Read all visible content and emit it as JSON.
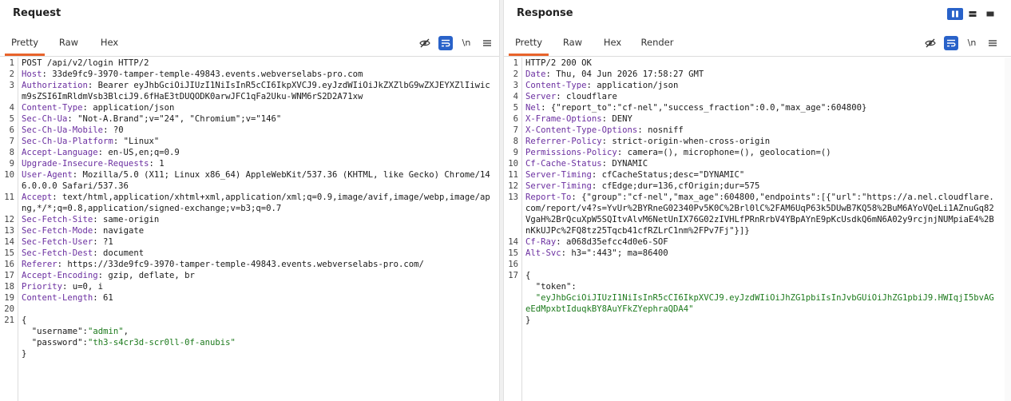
{
  "request": {
    "title": "Request",
    "tabs": [
      "Pretty",
      "Raw",
      "Hex"
    ],
    "active_tab": "Pretty",
    "newline_toggle": "\\n",
    "lines": [
      {
        "n": "1",
        "parts": [
          {
            "t": "POST /api/v2/login HTTP/2",
            "c": "hv"
          }
        ]
      },
      {
        "n": "2",
        "parts": [
          {
            "t": "Host",
            "c": "hk"
          },
          {
            "t": ": 33de9fc9-3970-tamper-temple-49843.events.webverselabs-pro.com",
            "c": "hv"
          }
        ]
      },
      {
        "n": "3",
        "parts": [
          {
            "t": "Authorization",
            "c": "hk"
          },
          {
            "t": ": Bearer eyJhbGciOiJIUzI1NiIsInR5cCI6IkpXVCJ9.eyJzdWIiOiJkZXZlbG9wZXJEYXZlIiwicm9sZSI6ImRldmVsb3BlciJ9.6fHaE3tDUQODK0arwJFC1qFa2Uku-WNM6rS2D2A71xw",
            "c": "hv"
          }
        ]
      },
      {
        "n": "4",
        "parts": [
          {
            "t": "Content-Type",
            "c": "hk"
          },
          {
            "t": ": application/json",
            "c": "hv"
          }
        ]
      },
      {
        "n": "5",
        "parts": [
          {
            "t": "Sec-Ch-Ua",
            "c": "hk"
          },
          {
            "t": ": \"Not-A.Brand\";v=\"24\", \"Chromium\";v=\"146\"",
            "c": "hv"
          }
        ]
      },
      {
        "n": "6",
        "parts": [
          {
            "t": "Sec-Ch-Ua-Mobile",
            "c": "hk"
          },
          {
            "t": ": ?0",
            "c": "hv"
          }
        ]
      },
      {
        "n": "7",
        "parts": [
          {
            "t": "Sec-Ch-Ua-Platform",
            "c": "hk"
          },
          {
            "t": ": \"Linux\"",
            "c": "hv"
          }
        ]
      },
      {
        "n": "8",
        "parts": [
          {
            "t": "Accept-Language",
            "c": "hk"
          },
          {
            "t": ": en-US,en;q=0.9",
            "c": "hv"
          }
        ]
      },
      {
        "n": "9",
        "parts": [
          {
            "t": "Upgrade-Insecure-Requests",
            "c": "hk"
          },
          {
            "t": ": 1",
            "c": "hv"
          }
        ]
      },
      {
        "n": "10",
        "parts": [
          {
            "t": "User-Agent",
            "c": "hk"
          },
          {
            "t": ": Mozilla/5.0 (X11; Linux x86_64) AppleWebKit/537.36 (KHTML, like Gecko) Chrome/146.0.0.0 Safari/537.36",
            "c": "hv"
          }
        ]
      },
      {
        "n": "11",
        "parts": [
          {
            "t": "Accept",
            "c": "hk"
          },
          {
            "t": ": text/html,application/xhtml+xml,application/xml;q=0.9,image/avif,image/webp,image/apng,*/*;q=0.8,application/signed-exchange;v=b3;q=0.7",
            "c": "hv"
          }
        ]
      },
      {
        "n": "12",
        "parts": [
          {
            "t": "Sec-Fetch-Site",
            "c": "hk"
          },
          {
            "t": ": same-origin",
            "c": "hv"
          }
        ]
      },
      {
        "n": "13",
        "parts": [
          {
            "t": "Sec-Fetch-Mode",
            "c": "hk"
          },
          {
            "t": ": navigate",
            "c": "hv"
          }
        ]
      },
      {
        "n": "14",
        "parts": [
          {
            "t": "Sec-Fetch-User",
            "c": "hk"
          },
          {
            "t": ": ?1",
            "c": "hv"
          }
        ]
      },
      {
        "n": "15",
        "parts": [
          {
            "t": "Sec-Fetch-Dest",
            "c": "hk"
          },
          {
            "t": ": document",
            "c": "hv"
          }
        ]
      },
      {
        "n": "16",
        "parts": [
          {
            "t": "Referer",
            "c": "hk"
          },
          {
            "t": ": https://33de9fc9-3970-tamper-temple-49843.events.webverselabs-pro.com/",
            "c": "hv"
          }
        ]
      },
      {
        "n": "17",
        "parts": [
          {
            "t": "Accept-Encoding",
            "c": "hk"
          },
          {
            "t": ": gzip, deflate, br",
            "c": "hv"
          }
        ]
      },
      {
        "n": "18",
        "parts": [
          {
            "t": "Priority",
            "c": "hk"
          },
          {
            "t": ": u=0, i",
            "c": "hv"
          }
        ]
      },
      {
        "n": "19",
        "parts": [
          {
            "t": "Content-Length",
            "c": "hk"
          },
          {
            "t": ": 61",
            "c": "hv"
          }
        ]
      },
      {
        "n": "20",
        "parts": [
          {
            "t": "",
            "c": "hv"
          }
        ]
      },
      {
        "n": "21",
        "parts": [
          {
            "t": "{",
            "c": "hv"
          }
        ]
      },
      {
        "n": "",
        "parts": [
          {
            "t": "  ",
            "c": "hv"
          },
          {
            "t": "\"username\"",
            "c": "jk"
          },
          {
            "t": ":",
            "c": "hv"
          },
          {
            "t": "\"admin\"",
            "c": "js"
          },
          {
            "t": ",",
            "c": "hv"
          }
        ]
      },
      {
        "n": "",
        "parts": [
          {
            "t": "  ",
            "c": "hv"
          },
          {
            "t": "\"password\"",
            "c": "jk"
          },
          {
            "t": ":",
            "c": "hv"
          },
          {
            "t": "\"th3-s4cr3d-scr0ll-0f-anubis\"",
            "c": "js"
          }
        ]
      },
      {
        "n": "",
        "parts": [
          {
            "t": "}",
            "c": "hv"
          }
        ]
      }
    ]
  },
  "response": {
    "title": "Response",
    "tabs": [
      "Pretty",
      "Raw",
      "Hex",
      "Render"
    ],
    "active_tab": "Pretty",
    "newline_toggle": "\\n",
    "lines": [
      {
        "n": "1",
        "parts": [
          {
            "t": "HTTP/2 200 OK",
            "c": "hv"
          }
        ]
      },
      {
        "n": "2",
        "parts": [
          {
            "t": "Date",
            "c": "hk"
          },
          {
            "t": ": Thu, 04 Jun 2026 17:58:27 GMT",
            "c": "hv"
          }
        ]
      },
      {
        "n": "3",
        "parts": [
          {
            "t": "Content-Type",
            "c": "hk"
          },
          {
            "t": ": application/json",
            "c": "hv"
          }
        ]
      },
      {
        "n": "4",
        "parts": [
          {
            "t": "Server",
            "c": "hk"
          },
          {
            "t": ": cloudflare",
            "c": "hv"
          }
        ]
      },
      {
        "n": "5",
        "parts": [
          {
            "t": "Nel",
            "c": "hk"
          },
          {
            "t": ": {\"report_to\":\"cf-nel\",\"success_fraction\":0.0,\"max_age\":604800}",
            "c": "hv"
          }
        ]
      },
      {
        "n": "6",
        "parts": [
          {
            "t": "X-Frame-Options",
            "c": "hk"
          },
          {
            "t": ": DENY",
            "c": "hv"
          }
        ]
      },
      {
        "n": "7",
        "parts": [
          {
            "t": "X-Content-Type-Options",
            "c": "hk"
          },
          {
            "t": ": nosniff",
            "c": "hv"
          }
        ]
      },
      {
        "n": "8",
        "parts": [
          {
            "t": "Referrer-Policy",
            "c": "hk"
          },
          {
            "t": ": strict-origin-when-cross-origin",
            "c": "hv"
          }
        ]
      },
      {
        "n": "9",
        "parts": [
          {
            "t": "Permissions-Policy",
            "c": "hk"
          },
          {
            "t": ": camera=(), microphone=(), geolocation=()",
            "c": "hv"
          }
        ]
      },
      {
        "n": "10",
        "parts": [
          {
            "t": "Cf-Cache-Status",
            "c": "hk"
          },
          {
            "t": ": DYNAMIC",
            "c": "hv"
          }
        ]
      },
      {
        "n": "11",
        "parts": [
          {
            "t": "Server-Timing",
            "c": "hk"
          },
          {
            "t": ": cfCacheStatus;desc=\"DYNAMIC\"",
            "c": "hv"
          }
        ]
      },
      {
        "n": "12",
        "parts": [
          {
            "t": "Server-Timing",
            "c": "hk"
          },
          {
            "t": ": cfEdge;dur=136,cfOrigin;dur=575",
            "c": "hv"
          }
        ]
      },
      {
        "n": "13",
        "parts": [
          {
            "t": "Report-To",
            "c": "hk"
          },
          {
            "t": ": {\"group\":\"cf-nel\",\"max_age\":604800,\"endpoints\":[{\"url\":\"https://a.nel.cloudflare.com/report/v4?s=YvUr%2BYRneG02340Pv5K0C%2Brl0lC%2FAM6UqP63k5DUwB7KQ58%2BuM6AYoVQeLi1AZnuGq82VgaH%2BrQcuXpW5SQItvAlvM6NetUnIX76G02zIVHLfPRnRrbV4YBpAYnE9pKcUsdkQ6mN6A02y9rcjnjNUMpiaE4%2BnKkUJPc%2FQ8tz25Tqcb41cfRZLrC1nm%2FPv7Fj\"}]}",
            "c": "hv"
          }
        ]
      },
      {
        "n": "14",
        "parts": [
          {
            "t": "Cf-Ray",
            "c": "hk"
          },
          {
            "t": ": a068d35efcc4d0e6-SOF",
            "c": "hv"
          }
        ]
      },
      {
        "n": "15",
        "parts": [
          {
            "t": "Alt-Svc",
            "c": "hk"
          },
          {
            "t": ": h3=\":443\"; ma=86400",
            "c": "hv"
          }
        ]
      },
      {
        "n": "16",
        "parts": [
          {
            "t": "",
            "c": "hv"
          }
        ]
      },
      {
        "n": "17",
        "parts": [
          {
            "t": "{",
            "c": "hv"
          }
        ]
      },
      {
        "n": "",
        "parts": [
          {
            "t": "  ",
            "c": "hv"
          },
          {
            "t": "\"token\"",
            "c": "jk"
          },
          {
            "t": ":",
            "c": "hv"
          }
        ]
      },
      {
        "n": "",
        "parts": [
          {
            "t": "  ",
            "c": "hv"
          },
          {
            "t": "\"eyJhbGciOiJIUzI1NiIsInR5cCI6IkpXVCJ9.eyJzdWIiOiJhZG1pbiIsInJvbGUiOiJhZG1pbiJ9.HWIqjI5bvAGeEdMpxbtIduqkBY8AuYFkZYephraQDA4\"",
            "c": "js"
          }
        ]
      },
      {
        "n": "",
        "parts": [
          {
            "t": "}",
            "c": "hv"
          }
        ]
      }
    ]
  },
  "icons": {
    "hide": "eye-off-icon",
    "wrap": "text-wrap-icon",
    "menu": "hamburger-menu-icon",
    "layout": [
      "layout-columns-icon",
      "layout-rows-icon",
      "layout-single-icon"
    ]
  },
  "colors": {
    "accent_tab": "#e8632b",
    "active_button": "#2962c9",
    "header_name": "#6b2fa0",
    "json_string": "#1d7a1d"
  }
}
